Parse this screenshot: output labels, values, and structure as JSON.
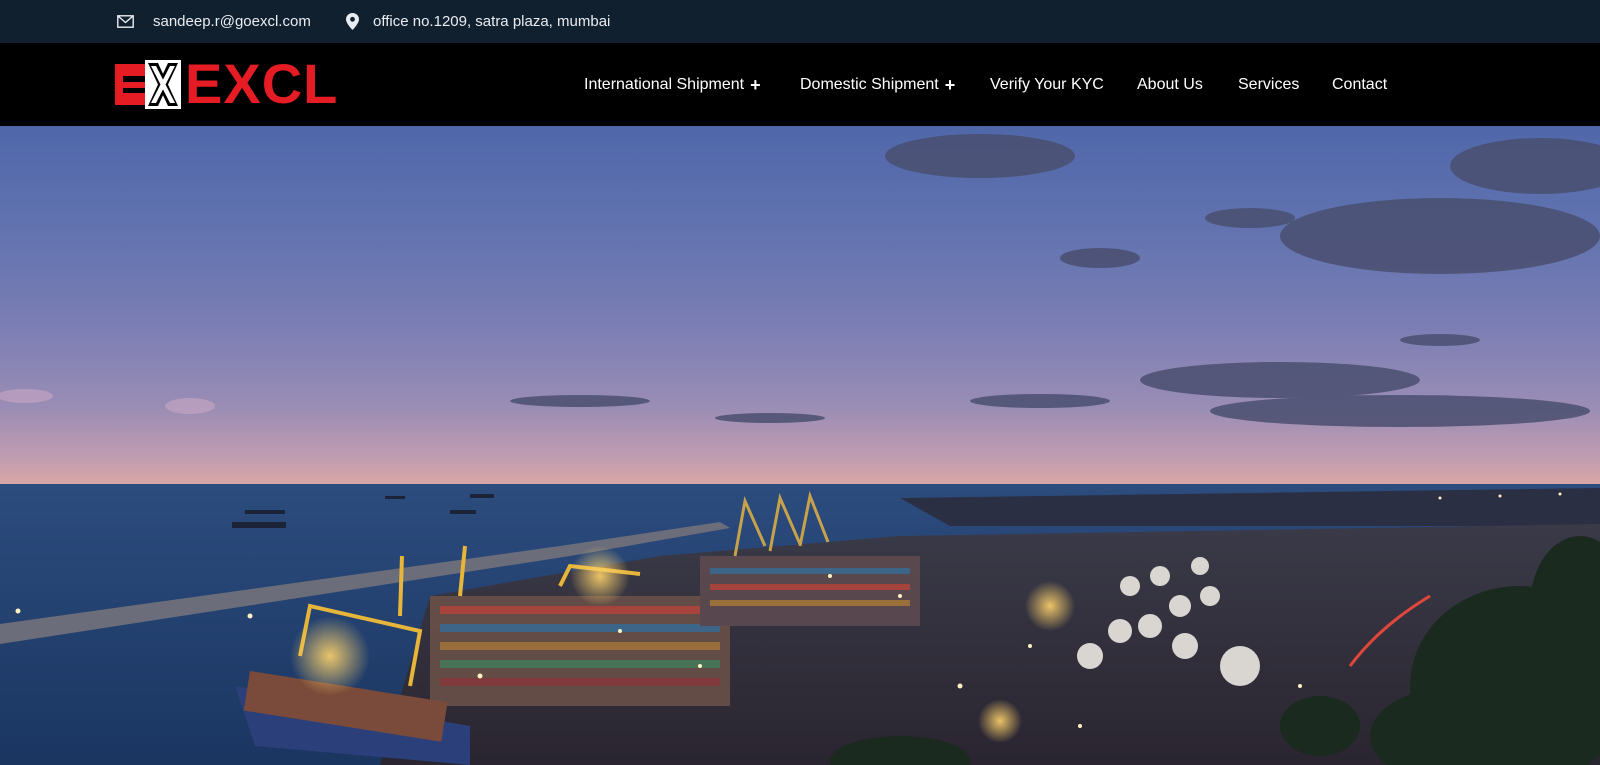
{
  "topbar": {
    "email": "sandeep.r@goexcl.com",
    "address": "office no.1209, satra plaza, mumbai",
    "email_icon": "envelope-icon",
    "address_icon": "map-pin-icon"
  },
  "brand": {
    "logo_text": "EXCL",
    "logo_mark_text": "ex",
    "color": "#e61c24"
  },
  "nav": {
    "items": [
      {
        "label": "International Shipment",
        "has_dropdown": true,
        "indicator": "+"
      },
      {
        "label": "Domestic Shipment",
        "has_dropdown": true,
        "indicator": "+"
      },
      {
        "label": "Verify Your KYC",
        "has_dropdown": false
      },
      {
        "label": "About Us",
        "has_dropdown": false
      },
      {
        "label": "Services",
        "has_dropdown": false
      },
      {
        "label": "Contact",
        "has_dropdown": false
      }
    ]
  },
  "colors": {
    "topbar_bg": "#11202f",
    "header_bg": "#000000",
    "accent": "#e61c24"
  },
  "hero": {
    "image": "port-at-dusk"
  }
}
